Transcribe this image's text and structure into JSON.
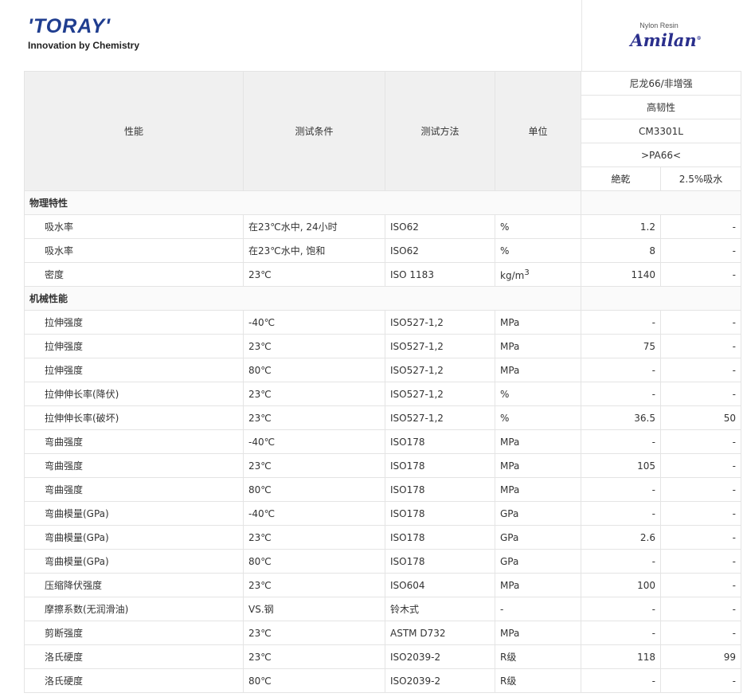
{
  "header": {
    "company": "'TORAY'",
    "tagline": "Innovation by Chemistry",
    "brand_small": "Nylon Resin",
    "brand_name": "Amilan",
    "brand_mark": "®"
  },
  "table": {
    "head": {
      "property": "性能",
      "condition": "测试条件",
      "method": "测试方法",
      "unit": "单位",
      "grade_type": "尼龙66/非增强",
      "feature": "高韧性",
      "grade": "CM3301L",
      "marking": ">PA66<",
      "dry": "絶乾",
      "wet": "2.5%吸水"
    },
    "sections": [
      {
        "title": "物理特性",
        "rows": [
          {
            "property": "吸水率",
            "condition": "在23℃水中, 24小时",
            "method": "ISO62",
            "unit": "%",
            "dry": "1.2",
            "wet": "-"
          },
          {
            "property": "吸水率",
            "condition": "在23℃水中, 饱和",
            "method": "ISO62",
            "unit": "%",
            "dry": "8",
            "wet": "-"
          },
          {
            "property": "密度",
            "condition": "23℃",
            "method": "ISO 1183",
            "unit": "kg/m",
            "unit_sup": "3",
            "dry": "1140",
            "wet": "-"
          }
        ]
      },
      {
        "title": "机械性能",
        "rows": [
          {
            "property": "拉伸强度",
            "condition": "-40℃",
            "method": "ISO527-1,2",
            "unit": "MPa",
            "dry": "-",
            "wet": "-"
          },
          {
            "property": "拉伸强度",
            "condition": "23℃",
            "method": "ISO527-1,2",
            "unit": "MPa",
            "dry": "75",
            "wet": "-"
          },
          {
            "property": "拉伸强度",
            "condition": "80℃",
            "method": "ISO527-1,2",
            "unit": "MPa",
            "dry": "-",
            "wet": "-"
          },
          {
            "property": "拉伸伸长率(降伏)",
            "condition": "23℃",
            "method": "ISO527-1,2",
            "unit": "%",
            "dry": "-",
            "wet": "-"
          },
          {
            "property": "拉伸伸长率(破坏)",
            "condition": "23℃",
            "method": "ISO527-1,2",
            "unit": "%",
            "dry": "36.5",
            "wet": "50"
          },
          {
            "property": "弯曲强度",
            "condition": "-40℃",
            "method": "ISO178",
            "unit": "MPa",
            "dry": "-",
            "wet": "-"
          },
          {
            "property": "弯曲强度",
            "condition": "23℃",
            "method": "ISO178",
            "unit": "MPa",
            "dry": "105",
            "wet": "-"
          },
          {
            "property": "弯曲强度",
            "condition": "80℃",
            "method": "ISO178",
            "unit": "MPa",
            "dry": "-",
            "wet": "-"
          },
          {
            "property": "弯曲模量(GPa)",
            "condition": "-40℃",
            "method": "ISO178",
            "unit": "GPa",
            "dry": "-",
            "wet": "-"
          },
          {
            "property": "弯曲模量(GPa)",
            "condition": "23℃",
            "method": "ISO178",
            "unit": "GPa",
            "dry": "2.6",
            "wet": "-"
          },
          {
            "property": "弯曲模量(GPa)",
            "condition": "80℃",
            "method": "ISO178",
            "unit": "GPa",
            "dry": "-",
            "wet": "-"
          },
          {
            "property": "压缩降伏强度",
            "condition": "23℃",
            "method": "ISO604",
            "unit": "MPa",
            "dry": "100",
            "wet": "-"
          },
          {
            "property": "摩擦系数(无润滑油)",
            "condition": "VS.钢",
            "method": "铃木式",
            "unit": "-",
            "dry": "-",
            "wet": "-"
          },
          {
            "property": "剪断强度",
            "condition": "23℃",
            "method": "ASTM D732",
            "unit": "MPa",
            "dry": "-",
            "wet": "-"
          },
          {
            "property": "洛氏硬度",
            "condition": "23℃",
            "method": "ISO2039-2",
            "unit": "R级",
            "dry": "118",
            "wet": "99"
          },
          {
            "property": "洛氏硬度",
            "condition": "80℃",
            "method": "ISO2039-2",
            "unit": "R级",
            "dry": "-",
            "wet": "-"
          }
        ]
      }
    ]
  },
  "colors": {
    "toray_blue": "#1f3d8f",
    "amilan_navy": "#2a2f8c",
    "header_bg": "#f0f0f0",
    "border": "#e4e4e4"
  }
}
